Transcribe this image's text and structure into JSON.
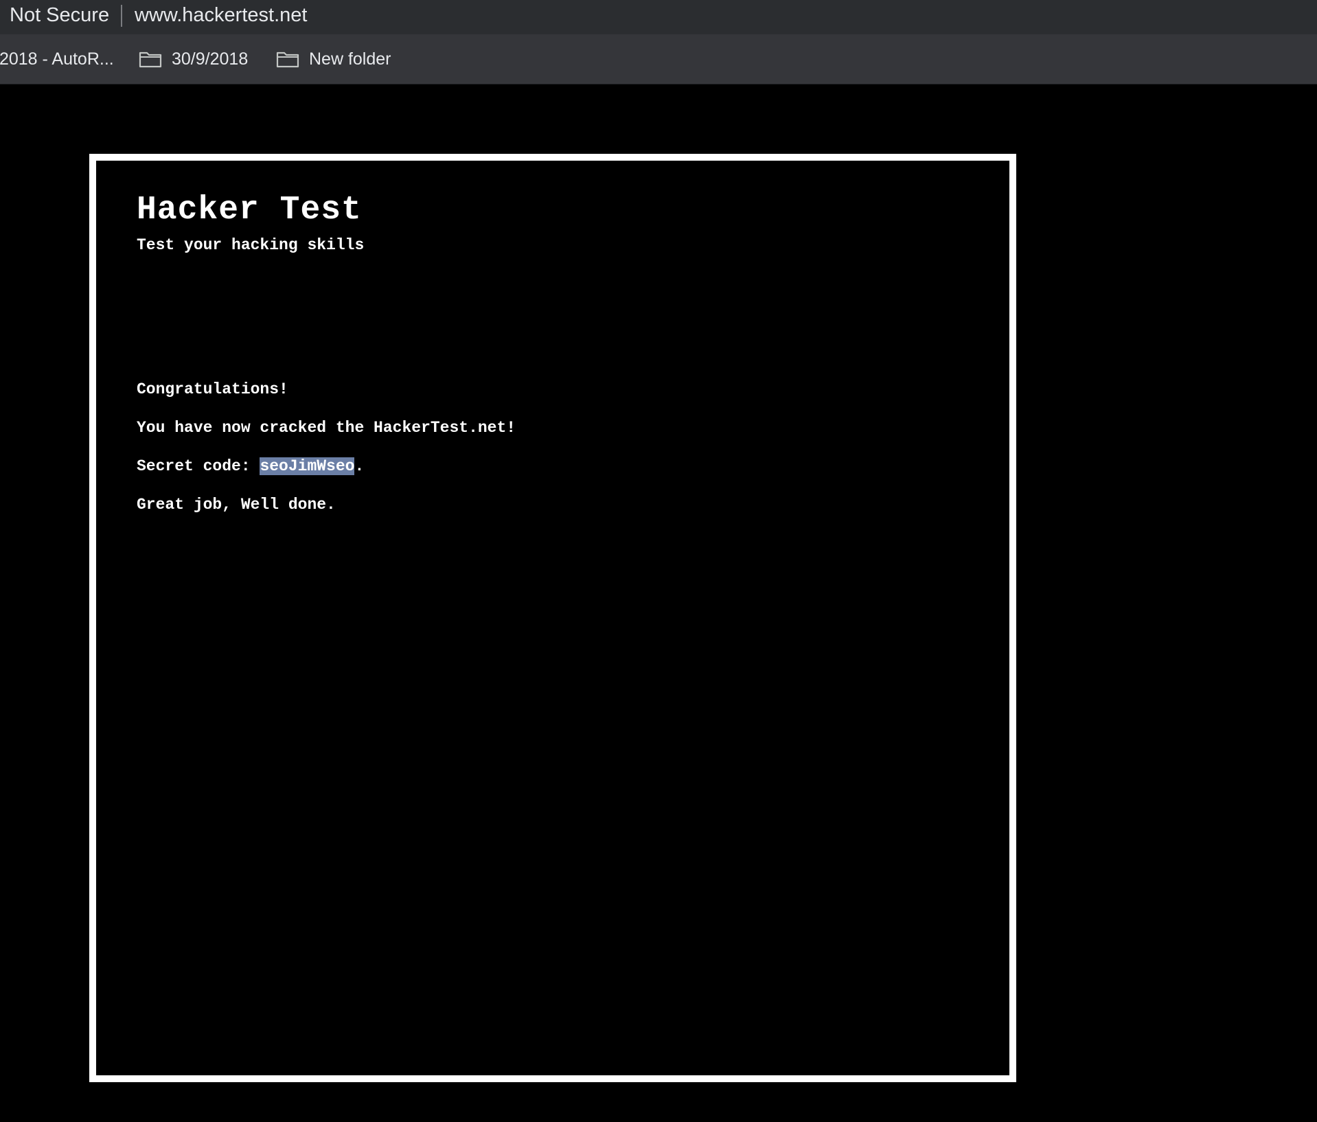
{
  "browser": {
    "security_label": "Not Secure",
    "url": "www.hackertest.net"
  },
  "bookmarks": [
    {
      "label": "/2018 - AutoR...",
      "icon": "none"
    },
    {
      "label": "30/9/2018",
      "icon": "folder-icon"
    },
    {
      "label": "New folder",
      "icon": "folder-icon"
    }
  ],
  "site": {
    "title": "Hacker Test",
    "subtitle": "Test your hacking skills"
  },
  "message": {
    "congrats": "Congratulations!",
    "cracked": "You have now cracked the HackerTest.net!",
    "secret_prefix": "Secret code: ",
    "secret_code": "seoJimWseo",
    "secret_suffix": ".",
    "closing": "Great job, Well done."
  },
  "colors": {
    "page_background": "#000000",
    "frame_border": "#ffffff",
    "selection_highlight": "#6b7fa6",
    "urlbar_background": "#2b2d30",
    "bookmarks_background": "#35363a"
  }
}
